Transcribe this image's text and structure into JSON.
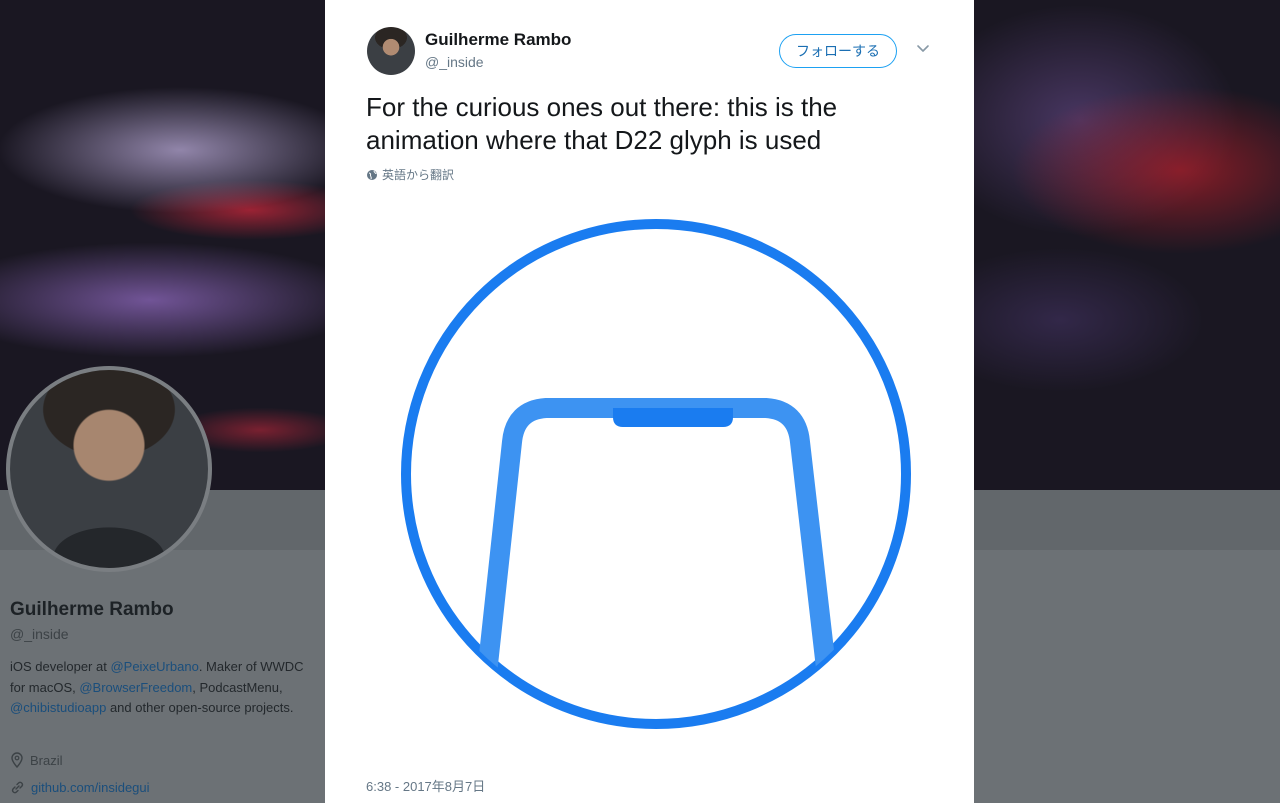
{
  "profile": {
    "name": "Guilherme Rambo",
    "handle": "@_inside",
    "bio": {
      "part1": "iOS developer at ",
      "link1": "@PeixeUrbano",
      "part2": ". Maker of WWDC for macOS, ",
      "link2": "@BrowserFreedom",
      "part3": ", PodcastMenu, ",
      "link3": "@chibistudioapp",
      "part4": " and other open-source projects."
    },
    "location": "Brazil",
    "url": "github.com/insidegui"
  },
  "tweet": {
    "author_name": "Guilherme Rambo",
    "author_handle": "@_inside",
    "follow_label": "フォローする",
    "caret_icon": "chevron-down-icon",
    "text": "For the curious ones out there: this is the animation where that D22 glyph is used",
    "translate_label": "英語から翻訳",
    "timestamp": "6:38 - 2017年8月7日",
    "media_description_icon": "phone-outline-glyph"
  },
  "colors": {
    "accent": "#1da1f2",
    "glyph_blue": "#1a7cf0"
  }
}
